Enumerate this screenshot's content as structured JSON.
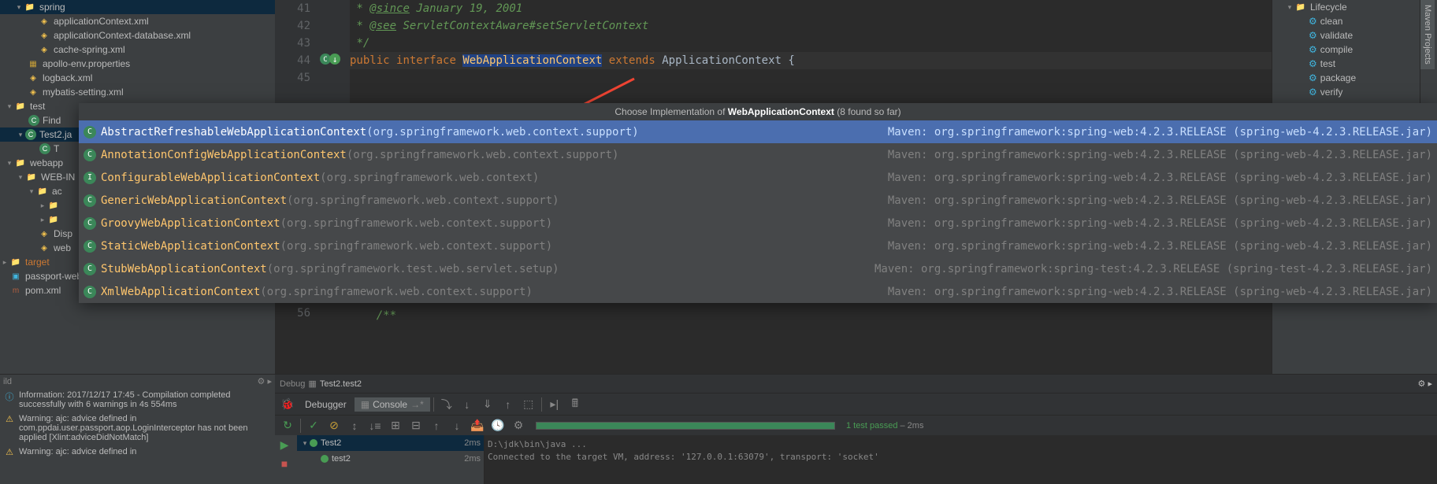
{
  "tree": {
    "spring_folder": "spring",
    "appContext": "applicationContext.xml",
    "appContextDb": "applicationContext-database.xml",
    "cacheSpring": "cache-spring.xml",
    "apolloEnv": "apollo-env.properties",
    "logback": "logback.xml",
    "mybatis": "mybatis-setting.xml",
    "test_folder": "test",
    "find": "Find",
    "test2java": "Test2.ja",
    "t_item": "T",
    "webapp": "webapp",
    "webinf": "WEB-IN",
    "ac": "ac",
    "disp": "Disp",
    "web": "web",
    "target": "target",
    "iml": "passport-web-api.iml",
    "pom": "pom.xml"
  },
  "editor": {
    "line41_no": "41",
    "line42_no": "42",
    "line43_no": "43",
    "line44_no": "44",
    "line45_no": "45",
    "line56_no": "56",
    "since_tag": "@since",
    "since_val": "January 19, 2001",
    "see_tag": "@see",
    "see_val": "ServletContextAware",
    "see_method": "#setServletContext",
    "close_comment": "*/",
    "kw_public": "public",
    "kw_interface": "interface",
    "type_name": "WebApplicationContext",
    "kw_extends": "extends",
    "supertype": "ApplicationContext",
    "brace": "{",
    "line56_comment": "/**"
  },
  "popup": {
    "title_prefix": "Choose Implementation of ",
    "title_class": "WebApplicationContext",
    "title_suffix": " (8 found so far)",
    "items": [
      {
        "name": "AbstractRefreshableWebApplicationContext",
        "pkg": "(org.springframework.web.context.support)",
        "right": "Maven: org.springframework:spring-web:4.2.3.RELEASE (spring-web-4.2.3.RELEASE.jar)",
        "selected": true,
        "icon": "C"
      },
      {
        "name": "AnnotationConfigWebApplicationContext",
        "pkg": "(org.springframework.web.context.support)",
        "right": "Maven: org.springframework:spring-web:4.2.3.RELEASE (spring-web-4.2.3.RELEASE.jar)",
        "selected": false,
        "icon": "C"
      },
      {
        "name": "ConfigurableWebApplicationContext",
        "pkg": "(org.springframework.web.context)",
        "right": "Maven: org.springframework:spring-web:4.2.3.RELEASE (spring-web-4.2.3.RELEASE.jar)",
        "selected": false,
        "icon": "I"
      },
      {
        "name": "GenericWebApplicationContext",
        "pkg": "(org.springframework.web.context.support)",
        "right": "Maven: org.springframework:spring-web:4.2.3.RELEASE (spring-web-4.2.3.RELEASE.jar)",
        "selected": false,
        "icon": "C"
      },
      {
        "name": "GroovyWebApplicationContext",
        "pkg": "(org.springframework.web.context.support)",
        "right": "Maven: org.springframework:spring-web:4.2.3.RELEASE (spring-web-4.2.3.RELEASE.jar)",
        "selected": false,
        "icon": "C"
      },
      {
        "name": "StaticWebApplicationContext",
        "pkg": "(org.springframework.web.context.support)",
        "right": "Maven: org.springframework:spring-web:4.2.3.RELEASE (spring-web-4.2.3.RELEASE.jar)",
        "selected": false,
        "icon": "C"
      },
      {
        "name": "StubWebApplicationContext",
        "pkg": "(org.springframework.test.web.servlet.setup)",
        "right": "Maven: org.springframework:spring-test:4.2.3.RELEASE (spring-test-4.2.3.RELEASE.jar)",
        "selected": false,
        "icon": "C"
      },
      {
        "name": "XmlWebApplicationContext",
        "pkg": "(org.springframework.web.context.support)",
        "right": "Maven: org.springframework:spring-web:4.2.3.RELEASE (spring-web-4.2.3.RELEASE.jar)",
        "selected": false,
        "icon": "C"
      }
    ]
  },
  "maven": {
    "lifecycle": "Lifecycle",
    "goals": [
      "clean",
      "validate",
      "compile",
      "test",
      "package",
      "verify"
    ],
    "tab": "Maven Projects"
  },
  "build": {
    "header": "ild",
    "info_text": "Information: 2017/12/17 17:45 - Compilation completed successfully with 6 warnings in 4s 554ms",
    "warn1": "Warning: ajc: advice defined in com.ppdai.user.passport.aop.LoginInterceptor has not been applied [Xlint:adviceDidNotMatch]",
    "warn2": "Warning: ajc: advice defined in"
  },
  "debug": {
    "header_label": "Debug",
    "header_test": "Test2.test2",
    "tab_debugger": "Debugger",
    "tab_console": "Console",
    "test_passed": "1 test passed",
    "test_time": " – 2ms",
    "tree_root": "Test2",
    "tree_root_time": "2ms",
    "tree_child": "test2",
    "tree_child_time": "2ms",
    "console_line1": "D:\\jdk\\bin\\java ...",
    "console_line2": "Connected to the target VM, address: '127.0.0.1:63079', transport: 'socket'"
  }
}
